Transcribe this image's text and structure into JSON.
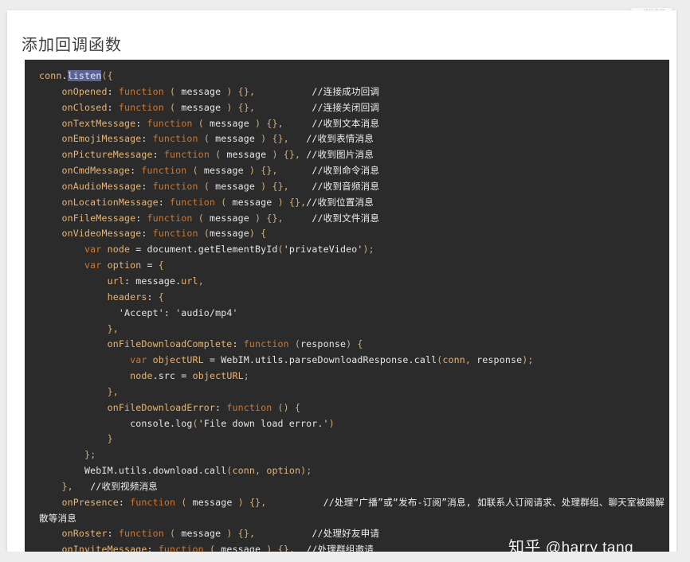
{
  "page": {
    "background": "#ededed",
    "card_background": "#ffffff"
  },
  "topbar": {
    "follow_chip": {
      "icon": "plus-icon",
      "icon_glyph": "+",
      "label": "关注专栏"
    }
  },
  "article": {
    "title": "添加回调函数"
  },
  "code_block": {
    "language": "javascript",
    "theme": {
      "background": "#2b2b2b",
      "text": "#d4d4d4",
      "property": "#e8b473",
      "keyword": "#cc7832",
      "punctuation": "#cfae7c",
      "comment": "#eeeeee",
      "selection_background": "#5b6496"
    },
    "selection": "listen",
    "lines": [
      "conn.listen({",
      "    onOpened: function ( message ) {},          //连接成功回调",
      "    onClosed: function ( message ) {},          //连接关闭回调",
      "    onTextMessage: function ( message ) {},     //收到文本消息",
      "    onEmojiMessage: function ( message ) {},   //收到表情消息",
      "    onPictureMessage: function ( message ) {}, //收到图片消息",
      "    onCmdMessage: function ( message ) {},      //收到命令消息",
      "    onAudioMessage: function ( message ) {},    //收到音频消息",
      "    onLocationMessage: function ( message ) {},//收到位置消息",
      "    onFileMessage: function ( message ) {},     //收到文件消息",
      "    onVideoMessage: function (message) {",
      "        var node = document.getElementById('privateVideo');",
      "        var option = {",
      "            url: message.url,",
      "            headers: {",
      "              'Accept': 'audio/mp4'",
      "            },",
      "            onFileDownloadComplete: function (response) {",
      "                var objectURL = WebIM.utils.parseDownloadResponse.call(conn, response);",
      "                node.src = objectURL;",
      "            },",
      "            onFileDownloadError: function () {",
      "                console.log('File down load error.')",
      "            }",
      "        };",
      "        WebIM.utils.download.call(conn, option);",
      "    },   //收到视频消息",
      "    onPresence: function ( message ) {},          //处理“广播”或“发布-订阅”消息, 如联系人订阅请求、处理群组、聊天室被踢解散等消息",
      "    onRoster: function ( message ) {},          //处理好友申请",
      "    onInviteMessage: function ( message ) {},  //处理群组邀请"
    ]
  },
  "watermark": {
    "site": "知乎",
    "handle": "@harry tang"
  }
}
